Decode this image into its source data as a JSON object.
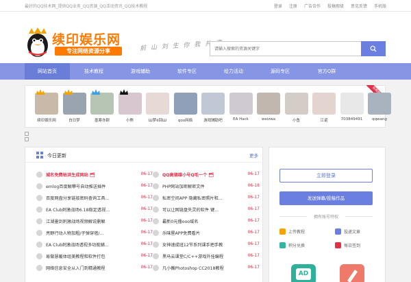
{
  "topbar": {
    "tagline": "最好的QQ技术网_提供QQ业务_QQ资源_QQ活动资讯_QQ技术教程",
    "links": [
      "登录",
      "注册",
      "广告合作",
      "投稿假级",
      "意见反馈",
      "手机版"
    ]
  },
  "header": {
    "logo_title": "续印娱乐网",
    "logo_sub": "专注网络资源分享",
    "slogan": "前 山 刘 生 你 我 共 享",
    "search_placeholder": "请输入搜索的资源关键字"
  },
  "nav": [
    "网站首页",
    "技术教程",
    "游戏辅助",
    "软件专区",
    "给力活动",
    "源码专区",
    "官方Q群"
  ],
  "avatars": {
    "ribbon": "投稿排行",
    "users": [
      {
        "name": "续印娱乐网",
        "color": "#c9b9a8"
      },
      {
        "name": "白日梦",
        "color": "#9aa4b0"
      },
      {
        "name": "墨寒亦尉",
        "color": "#b7c6b4"
      },
      {
        "name": "小熬",
        "color": "#d9c7cf"
      },
      {
        "name": "Ш梦ё回Ш",
        "color": "#e6d9d6"
      },
      {
        "name": "qoo网络",
        "color": "#8fa0b8"
      },
      {
        "name": "游戏辅助吧",
        "color": "#bfc8d4"
      },
      {
        "name": "EA Hack",
        "color": "#cfcad2"
      },
      {
        "name": "weizwa",
        "color": "#c2b7ae"
      },
      {
        "name": "小鱼",
        "color": "#d4ccc6"
      },
      {
        "name": "江诺",
        "color": "#e3d4d0"
      },
      {
        "name": "703849491",
        "color": "#e8e8e8"
      },
      {
        "name": "qqwang",
        "color": "#a8b3bf"
      }
    ]
  },
  "news": {
    "title": "今日更新",
    "more": "更多",
    "left": [
      {
        "t": "城名免费枯洪生成网站 🗂",
        "d": "06-17",
        "hot": true
      },
      {
        "t": "emlog百度解攀号自动推送插件",
        "d": "06-17",
        "hot": false
      },
      {
        "t": "百度网盘分享链接密码查询工具...",
        "d": "06-17",
        "hot": false
      },
      {
        "t": "EA Club刺激战场6.18稳定透视...",
        "d": "06-17",
        "hot": false
      },
      {
        "t": "江湖墨剑刺激战场视频解说删解",
        "d": "06-17",
        "hot": false
      },
      {
        "t": "亮野行动人物加粗/子弹穿墙/...",
        "d": "06-17",
        "hot": false
      },
      {
        "t": "EA Club刺激战场透视多功能辅...",
        "d": "06-17",
        "hot": false
      },
      {
        "t": "易做慧暖体组美教程和软件打包",
        "d": "06-17",
        "hot": false
      },
      {
        "t": "网络信息安全从入门到精通教程",
        "d": "06-17",
        "hot": false
      }
    ],
    "right": [
      {
        "t": "QQ高德雄小号Q毛一个 🗂",
        "d": "06-17",
        "hot": true
      },
      {
        "t": "PHP网站加密解密文件",
        "d": "06-18",
        "hot": false
      },
      {
        "t": "私密空间APP 隐藏私密照片和...",
        "d": "06-17",
        "hot": false
      },
      {
        "t": "可以让网链盘失灵的软件 键...",
        "d": "06-17",
        "hot": false
      },
      {
        "t": "最新0元撸ooo域名",
        "d": "06-17",
        "hot": false
      },
      {
        "t": "乐味屋APP免费看片",
        "d": "06-17",
        "hot": false
      },
      {
        "t": "女神速成班12节系列课手把手教",
        "d": "06-17",
        "hot": false
      },
      {
        "t": "黑马云课堂C/C++游戏外挂编程",
        "d": "06-17",
        "hot": false
      },
      {
        "t": "凡小巍Photoshop CC2018教程",
        "d": "06-17",
        "hot": false
      }
    ]
  },
  "side": {
    "login": "立即登录",
    "post": "发送弹幕/投稿作品",
    "priv": "拥有账号特权",
    "perks": [
      "上传教程",
      "投递文章",
      "积分兑换",
      "每日签到"
    ],
    "tile_label": "AD"
  }
}
